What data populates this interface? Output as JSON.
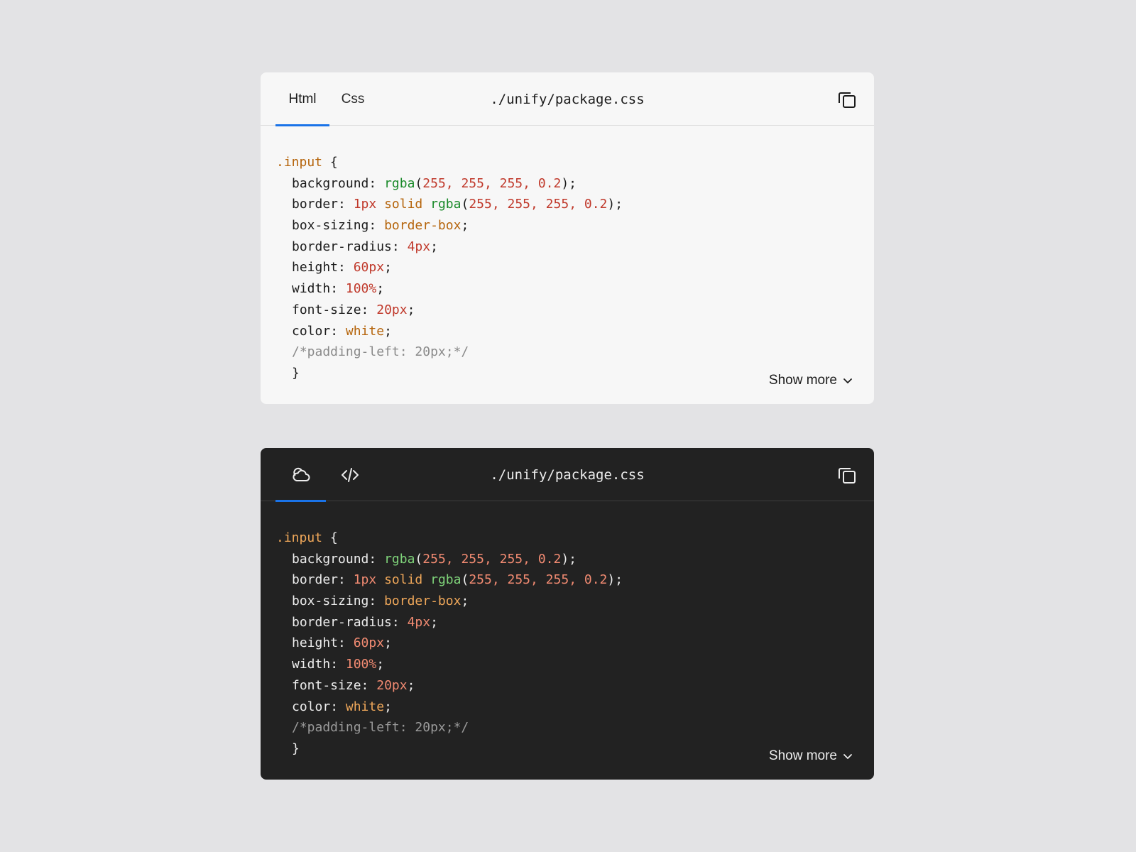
{
  "colors": {
    "accent": "#1a73e8",
    "page_bg": "#e3e3e5",
    "light_panel_bg": "#f7f7f7",
    "dark_panel_bg": "#222222"
  },
  "light_panel": {
    "tabs": [
      {
        "label": "Html",
        "active": true
      },
      {
        "label": "Css",
        "active": false
      }
    ],
    "filename": "./unify/package.css",
    "copy_icon": "copy-icon",
    "show_more_label": "Show more",
    "show_more_icon": "chevron-down-icon"
  },
  "dark_panel": {
    "tabs": [
      {
        "icon": "cloud-icon",
        "active": true
      },
      {
        "icon": "code-brackets-icon",
        "active": false
      }
    ],
    "filename": "./unify/package.css",
    "copy_icon": "copy-icon",
    "show_more_label": "Show more",
    "show_more_icon": "chevron-down-icon"
  },
  "code": [
    {
      "indent": false,
      "tokens": [
        {
          "t": ".input",
          "c": "sel"
        },
        {
          "t": " {",
          "c": "punc"
        }
      ]
    },
    {
      "indent": true,
      "tokens": [
        {
          "t": "background",
          "c": "prop"
        },
        {
          "t": ": ",
          "c": "punc"
        },
        {
          "t": "rgba",
          "c": "fn"
        },
        {
          "t": "(",
          "c": "punc"
        },
        {
          "t": "255, 255, 255, 0.2",
          "c": "num"
        },
        {
          "t": ");",
          "c": "punc"
        }
      ]
    },
    {
      "indent": true,
      "tokens": [
        {
          "t": "border",
          "c": "prop"
        },
        {
          "t": ": ",
          "c": "punc"
        },
        {
          "t": "1px",
          "c": "num"
        },
        {
          "t": " ",
          "c": "punc"
        },
        {
          "t": "solid",
          "c": "kw"
        },
        {
          "t": " ",
          "c": "punc"
        },
        {
          "t": "rgba",
          "c": "fn"
        },
        {
          "t": "(",
          "c": "punc"
        },
        {
          "t": "255, 255, 255, 0.2",
          "c": "num"
        },
        {
          "t": ");",
          "c": "punc"
        }
      ]
    },
    {
      "indent": true,
      "tokens": [
        {
          "t": "box-sizing",
          "c": "prop"
        },
        {
          "t": ": ",
          "c": "punc"
        },
        {
          "t": "border-box",
          "c": "kw"
        },
        {
          "t": ";",
          "c": "punc"
        }
      ]
    },
    {
      "indent": true,
      "tokens": [
        {
          "t": "border-radius",
          "c": "prop"
        },
        {
          "t": ": ",
          "c": "punc"
        },
        {
          "t": "4px",
          "c": "num"
        },
        {
          "t": ";",
          "c": "punc"
        }
      ]
    },
    {
      "indent": true,
      "tokens": [
        {
          "t": "height",
          "c": "prop"
        },
        {
          "t": ": ",
          "c": "punc"
        },
        {
          "t": "60px",
          "c": "num"
        },
        {
          "t": ";",
          "c": "punc"
        }
      ]
    },
    {
      "indent": true,
      "tokens": [
        {
          "t": "width",
          "c": "prop"
        },
        {
          "t": ": ",
          "c": "punc"
        },
        {
          "t": "100%",
          "c": "num"
        },
        {
          "t": ";",
          "c": "punc"
        }
      ]
    },
    {
      "indent": true,
      "tokens": [
        {
          "t": "font-size",
          "c": "prop"
        },
        {
          "t": ": ",
          "c": "punc"
        },
        {
          "t": "20px",
          "c": "num"
        },
        {
          "t": ";",
          "c": "punc"
        }
      ]
    },
    {
      "indent": true,
      "tokens": [
        {
          "t": "color",
          "c": "prop"
        },
        {
          "t": ": ",
          "c": "punc"
        },
        {
          "t": "white",
          "c": "kw"
        },
        {
          "t": ";",
          "c": "punc"
        }
      ]
    },
    {
      "indent": true,
      "tokens": [
        {
          "t": "/*padding-left: 20px;*/",
          "c": "com"
        }
      ]
    },
    {
      "indent": true,
      "tokens": [
        {
          "t": "}",
          "c": "punc"
        }
      ]
    }
  ]
}
